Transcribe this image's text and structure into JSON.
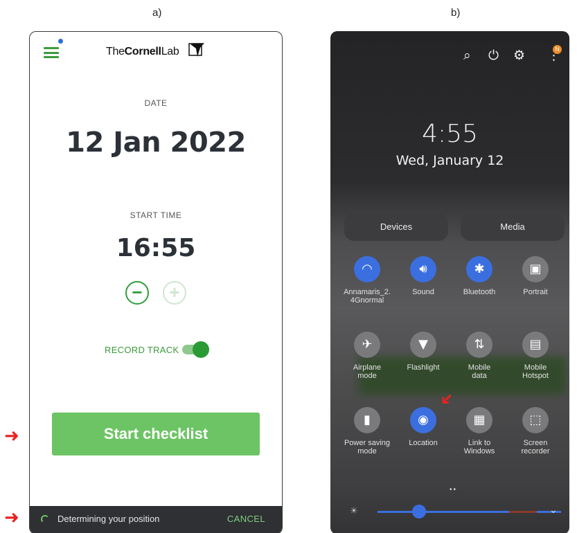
{
  "panels": {
    "a_label": "a)",
    "b_label": "b)"
  },
  "ebird": {
    "brand_pre": "The",
    "brand_bold": "Cornell",
    "brand_post": "Lab",
    "date_label": "DATE",
    "date_value": "12 Jan 2022",
    "start_time_label": "START TIME",
    "time_value": "16:55",
    "minus_symbol": "−",
    "plus_symbol": "+",
    "record_track_label": "RECORD TRACK",
    "start_button": "Start checklist",
    "status_text": "Determining your position",
    "cancel_label": "CANCEL",
    "accent_color": "#3a9d3a"
  },
  "android": {
    "badge": "N",
    "clock_time": "4:55",
    "clock_date": "Wed, January 12",
    "devices_label": "Devices",
    "media_label": "Media",
    "tiles": [
      {
        "label": "Annamaris_2.\n4Gnormal",
        "icon": "wifi-icon",
        "on": true
      },
      {
        "label": "Sound",
        "icon": "volume-icon",
        "on": true
      },
      {
        "label": "Bluetooth",
        "icon": "bluetooth-icon",
        "on": true
      },
      {
        "label": "Portrait",
        "icon": "rotation-lock-icon",
        "on": false
      },
      {
        "label": "Airplane\nmode",
        "icon": "airplane-icon",
        "on": false
      },
      {
        "label": "Flashlight",
        "icon": "flashlight-icon",
        "on": false
      },
      {
        "label": "Mobile\ndata",
        "icon": "mobile-data-icon",
        "on": false
      },
      {
        "label": "Mobile\nHotspot",
        "icon": "hotspot-icon",
        "on": false
      },
      {
        "label": "Power saving\nmode",
        "icon": "battery-icon",
        "on": false
      },
      {
        "label": "Location",
        "icon": "location-pin-icon",
        "on": true
      },
      {
        "label": "Link to\nWindows",
        "icon": "link-to-windows-icon",
        "on": false
      },
      {
        "label": "Screen\nrecorder",
        "icon": "screen-recorder-icon",
        "on": false
      }
    ],
    "accent_color": "#3b6fe0",
    "brightness_level": 0.2
  }
}
